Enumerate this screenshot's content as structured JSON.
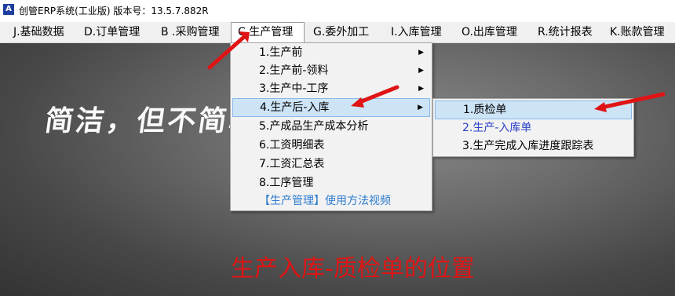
{
  "window": {
    "title": "创管ERP系统(工业版) 版本号：13.5.7.882R",
    "icon": "app-logo-icon"
  },
  "menubar": {
    "items": [
      {
        "label": "J.基础数据"
      },
      {
        "label": "D.订单管理"
      },
      {
        "label": "B .采购管理"
      },
      {
        "label": "C.生产管理"
      },
      {
        "label": "G.委外加工"
      },
      {
        "label": "I.入库管理"
      },
      {
        "label": "O.出库管理"
      },
      {
        "label": "R.统计报表"
      },
      {
        "label": "K.账款管理"
      }
    ]
  },
  "dropdown": {
    "items": [
      {
        "label": "1.生产前",
        "has_submenu": true
      },
      {
        "label": "2.生产前-领料",
        "has_submenu": true
      },
      {
        "label": "3.生产中-工序",
        "has_submenu": true
      },
      {
        "label": "4.生产后-入库",
        "has_submenu": true
      },
      {
        "label": "5.产成品生产成本分析"
      },
      {
        "label": "6.工资明细表"
      },
      {
        "label": "7.工资汇总表"
      },
      {
        "label": "8.工序管理"
      },
      {
        "label": "【生产管理】使用方法视频"
      }
    ],
    "submenu_arrow": "▶"
  },
  "submenu": {
    "items": [
      {
        "label": "1.质检单"
      },
      {
        "label": "2.生产-入库单"
      },
      {
        "label": "3.生产完成入库进度跟踪表"
      }
    ]
  },
  "background": {
    "slogan": "简洁，但不简单！",
    "caption": "生产入库-质检单的位置"
  },
  "colors": {
    "annotation_red": "#e01414",
    "highlight": "#cde4f7",
    "link_blue": "#2a3fc8"
  }
}
